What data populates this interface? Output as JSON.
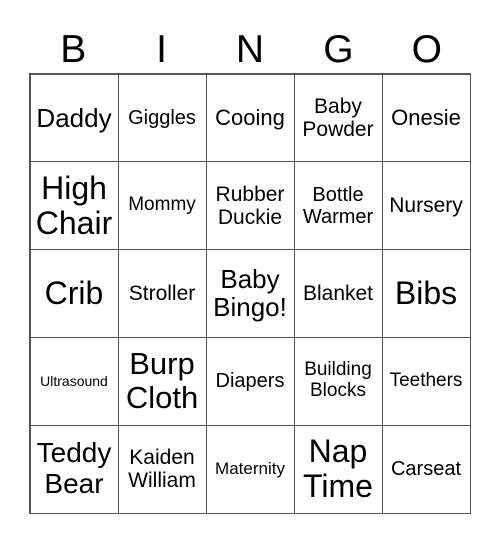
{
  "header": [
    "B",
    "I",
    "N",
    "G",
    "O"
  ],
  "cells": [
    [
      "Daddy",
      "Giggles",
      "Cooing",
      "Baby\nPowder",
      "Onesie"
    ],
    [
      "High\nChair",
      "Mommy",
      "Rubber\nDuckie",
      "Bottle\nWarmer",
      "Nursery"
    ],
    [
      "Crib",
      "Stroller",
      "Baby\nBingo!",
      "Blanket",
      "Bibs"
    ],
    [
      "Ultrasound",
      "Burp\nCloth",
      "Diapers",
      "Building\nBlocks",
      "Teethers"
    ],
    [
      "Teddy\nBear",
      "Kaiden\nWilliam",
      "Maternity",
      "Nap\nTime",
      "Carseat"
    ]
  ]
}
